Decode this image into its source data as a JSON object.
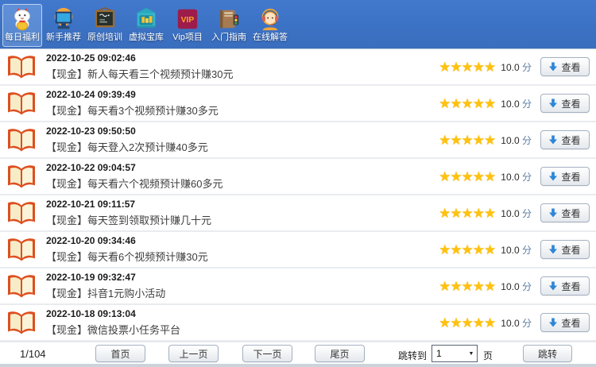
{
  "nav": {
    "items": [
      {
        "label": "每日福利",
        "selected": true
      },
      {
        "label": "新手推荐",
        "selected": false
      },
      {
        "label": "原创培训",
        "selected": false
      },
      {
        "label": "虚拟宝库",
        "selected": false
      },
      {
        "label": "Vip项目",
        "selected": false
      },
      {
        "label": "入门指南",
        "selected": false
      },
      {
        "label": "在线解答",
        "selected": false
      }
    ],
    "vip_icon_text": "VIP"
  },
  "list": {
    "stars_text": "★★★★★",
    "score_unit": "分",
    "view_label": "查看",
    "rows": [
      {
        "date": "2022-10-25 09:02:46",
        "title": "【现金】新人每天看三个视频预计赚30元",
        "score": "10.0"
      },
      {
        "date": "2022-10-24 09:39:49",
        "title": "【现金】每天看3个视频预计赚30多元",
        "score": "10.0"
      },
      {
        "date": "2022-10-23 09:50:50",
        "title": "【现金】每天登入2次预计赚40多元",
        "score": "10.0"
      },
      {
        "date": "2022-10-22 09:04:57",
        "title": "【现金】每天看六个视频预计赚60多元",
        "score": "10.0"
      },
      {
        "date": "2022-10-21 09:11:57",
        "title": "【现金】每天签到领取预计赚几十元",
        "score": "10.0"
      },
      {
        "date": "2022-10-20 09:34:46",
        "title": "【现金】每天看6个视频预计赚30元",
        "score": "10.0"
      },
      {
        "date": "2022-10-19 09:32:47",
        "title": "【现金】抖音1元购小活动",
        "score": "10.0"
      },
      {
        "date": "2022-10-18 09:13:04",
        "title": "【现金】微信投票小任务平台",
        "score": "10.0"
      }
    ]
  },
  "pagination": {
    "indicator": "1/104",
    "first": "首页",
    "prev": "上一页",
    "next": "下一页",
    "last": "尾页",
    "jump_to": "跳转到",
    "page_value": "1",
    "page_unit": "页",
    "jump": "跳转"
  },
  "colors": {
    "navbar_blue": "#3C71C3",
    "star_gold": "#FFC20E",
    "arrow_blue": "#2E86D6",
    "vip_red": "#9E1C4C",
    "book_orange": "#DD4F1F"
  }
}
